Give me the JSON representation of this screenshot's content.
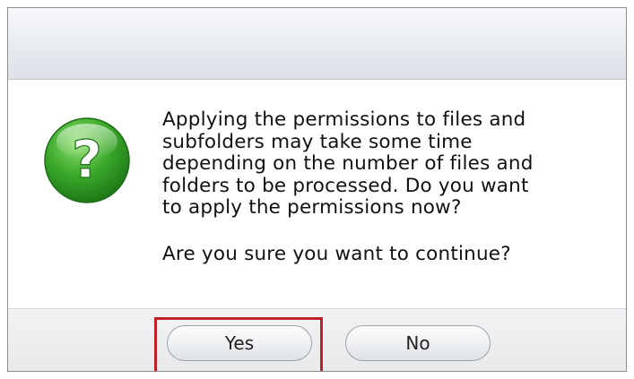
{
  "dialog": {
    "icon": "question-icon",
    "message_lines": [
      "Applying the permissions to files and",
      "subfolders may take some time",
      "depending on the number of files and",
      "folders to be processed. Do you want",
      "to apply the permissions now?"
    ],
    "confirm_question": "Are you sure you want to continue?",
    "buttons": {
      "yes_label": "Yes",
      "no_label": "No"
    },
    "highlight_color": "#c0202a",
    "icon_color": "#3aa82a"
  }
}
